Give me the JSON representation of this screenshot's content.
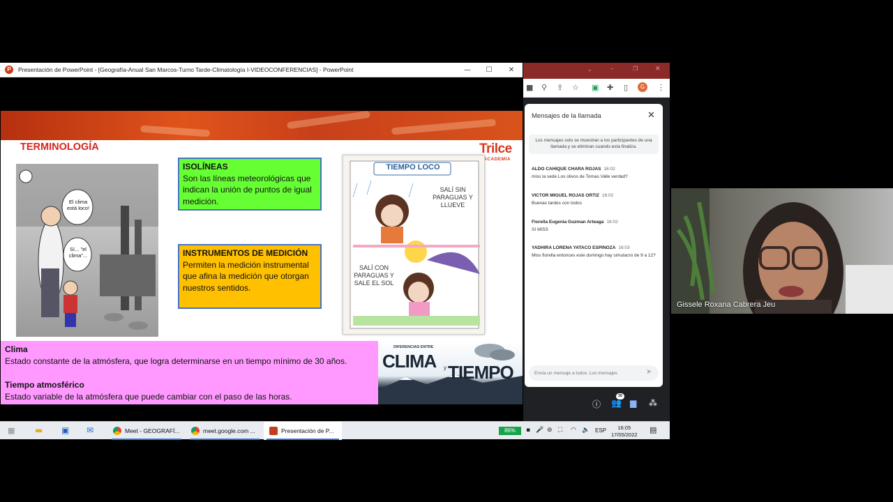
{
  "ppt": {
    "title": "Presentación de PowerPoint - [Geografía-Anual San Marcos-Turno Tarde-Climatología I-VIDEOCONFERENCIAS] - PowerPoint",
    "app_icon_letter": "P",
    "controls": {
      "minimize": "—",
      "maximize": "☐",
      "close": "✕"
    }
  },
  "slide": {
    "heading": "TERMINOLOGÍA",
    "logo": "Trilce",
    "logo_sub": "ACADEMIA",
    "isolineas": {
      "title": "ISOLÍNEAS",
      "body": "Son las líneas meteorológicas que indican la unión de puntos de igual medición."
    },
    "instrumentos": {
      "title": "INSTRUMENTOS DE MEDICIÓN",
      "body": "Permiten la medición instrumental que afina la medición que otorgan nuestros sentidos."
    },
    "cartoon": {
      "bubble1": "El clima está loco!",
      "bubble2": "Sí... \"el clima\"..."
    },
    "comic": {
      "title": "TIEMPO LOCO",
      "text1": "SALÍ SIN PARAGUAS Y LLUEVE",
      "text2": "SALÍ CON PARAGUAS Y SALE EL SOL"
    },
    "clima_def_title": "Clima",
    "clima_def_body": "Estado constante de la atmósfera, que logra determinarse en un tiempo mínimo de 30 años.",
    "tiempo_def_title": "Tiempo atmosférico",
    "tiempo_def_body": "Estado variable de la atmósfera que puede cambiar con el paso de las horas.",
    "clima_img": {
      "small": "DIFERENCIAS ENTRE",
      "big1": "CLIMA",
      "y": "y",
      "big2": "TIEMPO"
    }
  },
  "chat": {
    "title": "Mensajes de la llamada",
    "notice": "Los mensajes solo se muestran a los participantes de una llamada y se eliminan cuando esta finaliza.",
    "messages": [
      {
        "sender": "ALDO CAHIQUE CHARA ROJAS",
        "time": "16:02",
        "text": "miss la sede Los olivos de Tomas Valle verdad?"
      },
      {
        "sender": "VICTOR MIGUEL ROJAS ORTIZ",
        "time": "16:02",
        "text": "Buenas tardes con todos"
      },
      {
        "sender": "Fiorella Eugenia Guzman Arteaga",
        "time": "16:02",
        "text": "SI MISS"
      },
      {
        "sender": "YADHIRA LORENA YATACO ESPINOZA",
        "time": "16:03",
        "text": "Miss fiorella entonces este domingo hay simulacro de 9 a 12?"
      }
    ],
    "input_placeholder": "Envía un mensaje a todos. Los mensajes",
    "people_count": "30"
  },
  "webcam": {
    "name": "Gissele Roxana Cabrera Jeu"
  },
  "taskbar": {
    "apps": [
      {
        "label": "Meet - GEOGRAFÍ...",
        "color": "#db4437"
      },
      {
        "label": "meet.google.com ...",
        "color": "#db4437"
      },
      {
        "label": "Presentación de P...",
        "color": "#c43e1c"
      }
    ],
    "battery": "86%",
    "lang": "ESP",
    "time": "16:05",
    "date": "17/05/2022"
  }
}
